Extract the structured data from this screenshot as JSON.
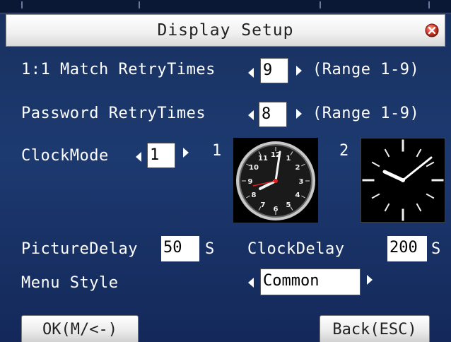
{
  "window": {
    "title": "Display Setup",
    "close_icon": "close-icon"
  },
  "settings": {
    "match_retry": {
      "label": "1:1 Match RetryTimes",
      "value": "9",
      "range": "(Range 1-9)"
    },
    "password_retry": {
      "label": "Password RetryTimes",
      "value": "8",
      "range": "(Range 1-9)"
    },
    "clock_mode": {
      "label": "ClockMode",
      "value": "1",
      "option_1_label": "1",
      "option_2_label": "2",
      "option_1_icon": "analog-clock-icon",
      "option_2_icon": "minimal-clock-icon"
    },
    "picture_delay": {
      "label": "PictureDelay",
      "value": "50",
      "unit": "S"
    },
    "clock_delay": {
      "label": "ClockDelay",
      "value": "200",
      "unit": "S"
    },
    "menu_style": {
      "label": "Menu Style",
      "value": "Common"
    }
  },
  "buttons": {
    "ok_label": "OK(M/<-)",
    "back_label": "Back(ESC)"
  },
  "colors": {
    "background": "#1d3a70",
    "text": "#ffffff",
    "field": "#ffffff",
    "close_button": "#d23a2a"
  }
}
